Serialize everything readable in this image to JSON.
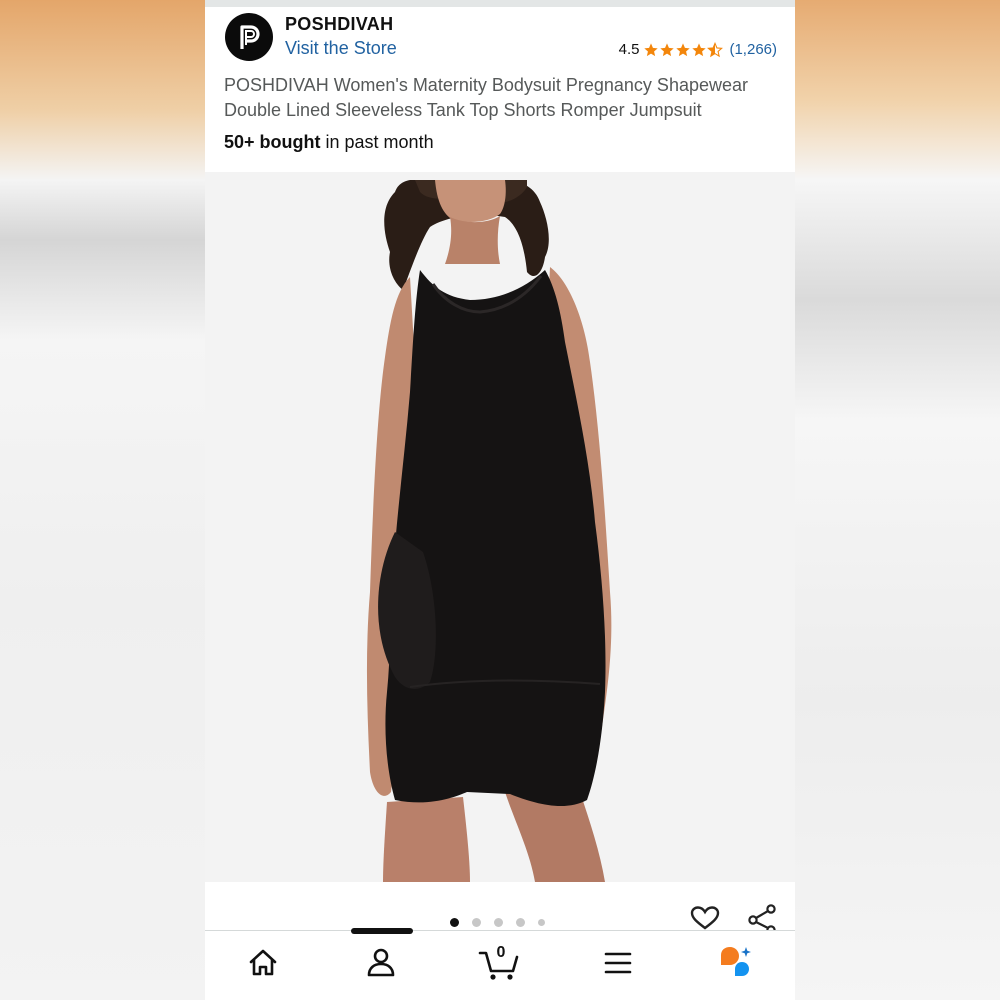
{
  "store": {
    "name": "POSHDIVAH",
    "visit_label": "Visit the Store",
    "rating": "4.5",
    "rating_count": "(1,266)"
  },
  "product": {
    "title": "POSHDIVAH Women's Maternity Bodysuit Pregnancy Shapewear Double Lined Sleeveless Tank Top Shorts Romper Jumpsuit",
    "bought_bold": "50+ bought",
    "bought_rest": " in past month",
    "image_count": 5,
    "active_image": 1
  },
  "actions": {
    "favorite_icon": "heart-outline-icon",
    "share_icon": "share-icon"
  },
  "bottom_nav": {
    "items": [
      "home-icon",
      "account-icon",
      "cart-icon",
      "menu-icon",
      "rufus-ai-icon"
    ],
    "cart_count": "0"
  },
  "colors": {
    "link": "#2162a1",
    "star": "#f3860b",
    "title": "#565959"
  }
}
